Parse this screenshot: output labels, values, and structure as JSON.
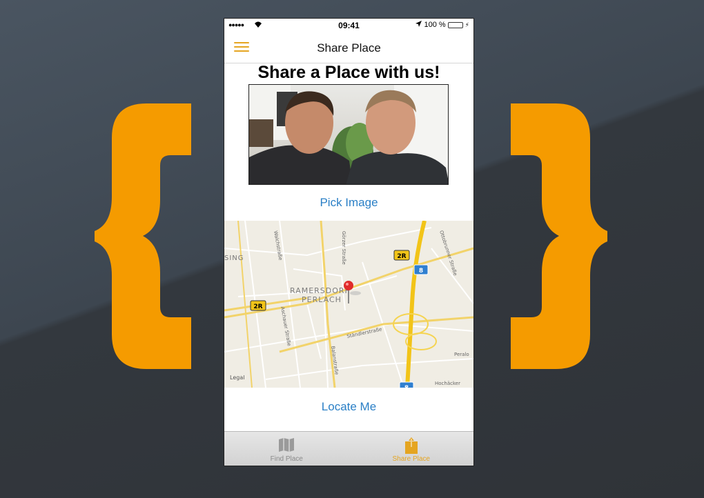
{
  "status_bar": {
    "signal": "●●●●●",
    "time": "09:41",
    "battery_text": "100 %",
    "battery_level": 1.0
  },
  "nav": {
    "title": "Share Place",
    "accent_color": "#e5a521"
  },
  "main": {
    "heading": "Share a Place with us!",
    "pick_image_label": "Pick Image",
    "locate_me_label": "Locate Me",
    "link_color": "#2a7fc6"
  },
  "map": {
    "district": [
      "RAMERSDORF",
      "PERLACH"
    ],
    "shields": [
      "2R",
      "2R",
      "8",
      "8"
    ],
    "streets": [
      "Walchstraße",
      "Görzer Straße",
      "Ottobrunner Straße",
      "Aschauer Straße",
      "Ständlerstraße",
      "Balanstraße",
      "Peralo",
      "Hochäcker"
    ],
    "edge_labels": [
      "SING",
      "Legal"
    ]
  },
  "tabs": [
    {
      "label": "Find Place",
      "icon": "map-icon",
      "active": false
    },
    {
      "label": "Share Place",
      "icon": "share-icon",
      "active": true
    }
  ],
  "background": {
    "brace_color": "#f59b00",
    "brace_left": "{",
    "brace_right": "}"
  }
}
